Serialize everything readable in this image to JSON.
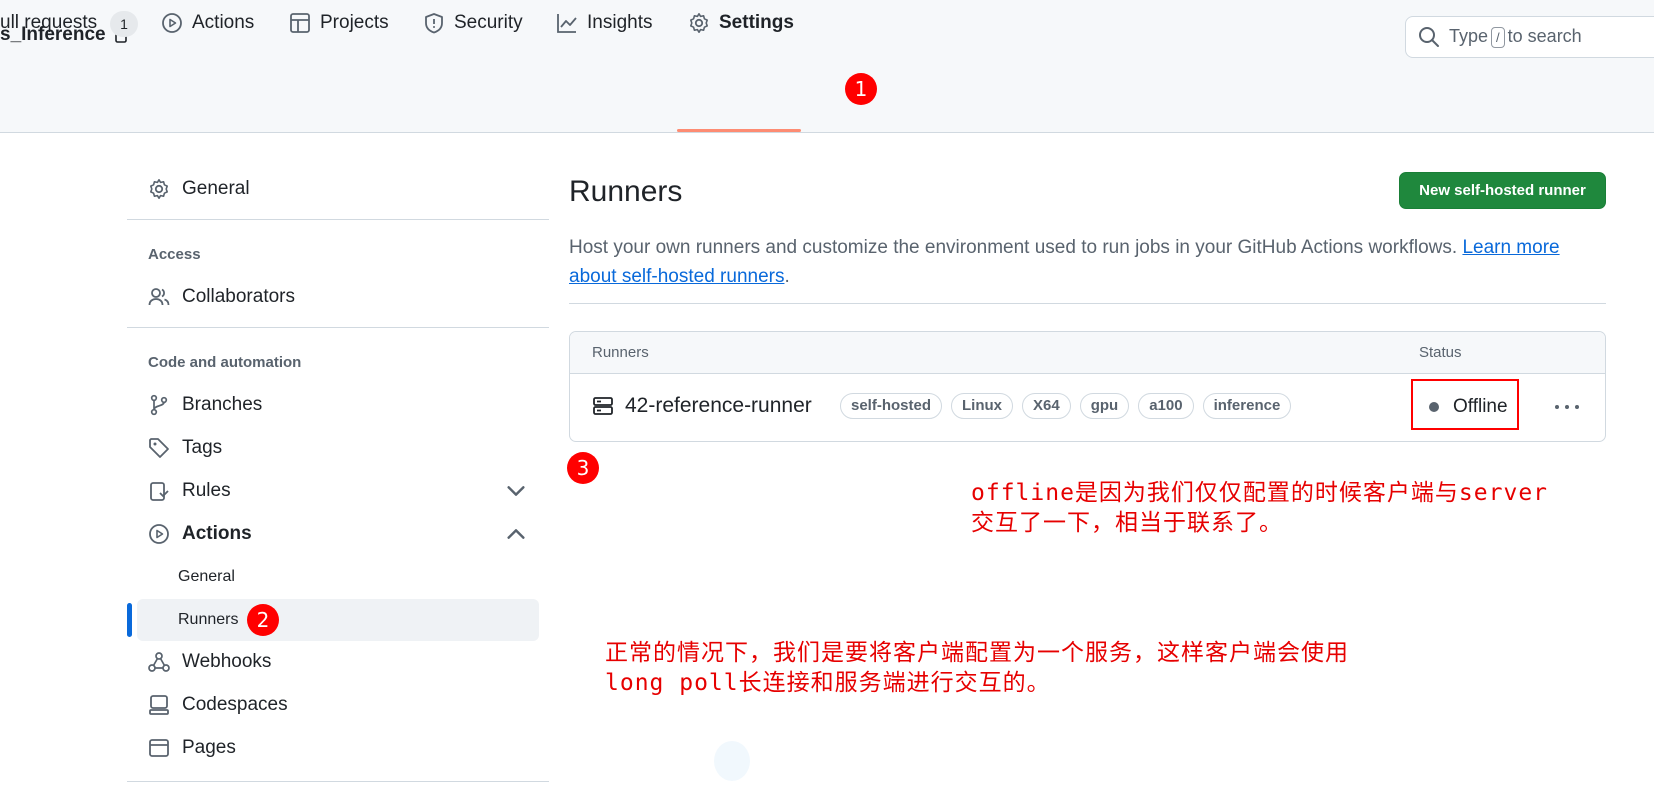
{
  "repo": {
    "name": "s_Inference",
    "lock_icon": "lock-icon"
  },
  "search": {
    "prefix": "Type",
    "key": "/",
    "suffix": "to search",
    "placeholder": ""
  },
  "tabs": [
    {
      "label": "ull requests",
      "counter": "1",
      "icon": "pull-request-icon"
    },
    {
      "label": "Actions",
      "icon": "play-icon"
    },
    {
      "label": "Projects",
      "icon": "table-icon"
    },
    {
      "label": "Security",
      "icon": "shield-icon"
    },
    {
      "label": "Insights",
      "icon": "graph-icon"
    },
    {
      "label": "Settings",
      "icon": "gear-icon",
      "selected": true
    }
  ],
  "markers": {
    "m1": "1",
    "m2": "2",
    "m3": "3"
  },
  "sidebar": {
    "general": "General",
    "access_heading": "Access",
    "collaborators": "Collaborators",
    "code_heading": "Code and automation",
    "branches": "Branches",
    "tags": "Tags",
    "rules": "Rules",
    "actions": "Actions",
    "actions_general": "General",
    "actions_runners": "Runners",
    "webhooks": "Webhooks",
    "codespaces": "Codespaces",
    "pages": "Pages"
  },
  "main": {
    "title": "Runners",
    "new_button": "New self-hosted runner",
    "description": "Host your own runners and customize the environment used to run jobs in your GitHub Actions workflows.",
    "learn_more": "Learn more about self-hosted runners",
    "table": {
      "col_runners": "Runners",
      "col_status": "Status",
      "runner": {
        "name": "42-reference-runner",
        "labels": [
          "self-hosted",
          "Linux",
          "X64",
          "gpu",
          "a100",
          "inference"
        ],
        "status": "Offline"
      }
    }
  },
  "annotations": {
    "note1_line1": "offline是因为我们仅仅配置的时候客户端与server",
    "note1_line2": "交互了一下，相当于联系了。",
    "note2_line1": "正常的情况下，我们是要将客户端配置为一个服务，这样客户端会使用",
    "note2_line2": "long poll长连接和服务端进行交互的。"
  },
  "colors": {
    "accent_green": "#1f883d",
    "link_blue": "#0969da",
    "annotation_red": "#ff0000",
    "tab_underline": "#fd8c73"
  }
}
